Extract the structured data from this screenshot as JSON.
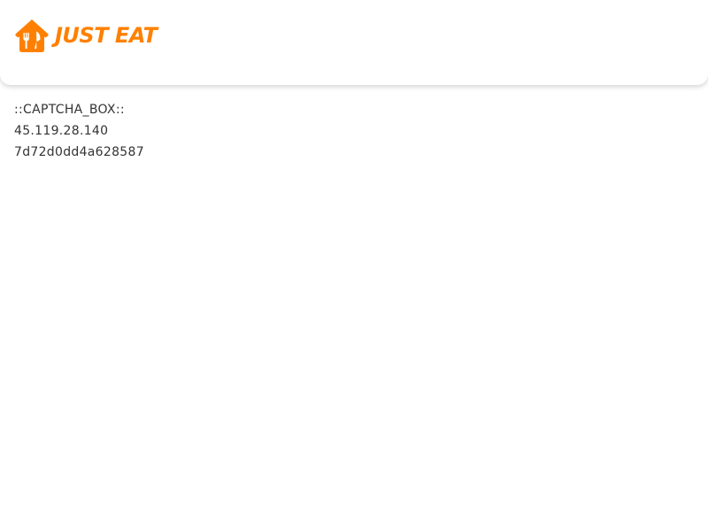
{
  "brand": {
    "name": "JUST EAT",
    "accent_color": "#ff8000",
    "logo_icon": "house-fork-knife-icon"
  },
  "page": {
    "lines": [
      "::CAPTCHA_BOX::",
      "45.119.28.140",
      "7d72d0dd4a628587"
    ]
  }
}
